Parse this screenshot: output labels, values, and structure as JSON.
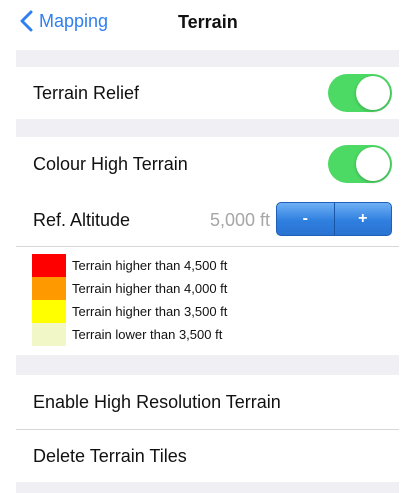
{
  "nav": {
    "back_label": "Mapping",
    "title": "Terrain"
  },
  "settings": {
    "terrain_relief": {
      "label": "Terrain Relief",
      "on": true
    },
    "colour_high_terrain": {
      "label": "Colour High Terrain",
      "on": true
    },
    "ref_altitude": {
      "label": "Ref. Altitude",
      "value": "5,000 ft",
      "minus_label": "-",
      "plus_label": "+"
    },
    "legend": [
      {
        "color": "#ff0000",
        "text": "Terrain higher than 4,500 ft"
      },
      {
        "color": "#ff9900",
        "text": "Terrain higher than 4,000 ft"
      },
      {
        "color": "#ffff00",
        "text": "Terrain higher than 3,500 ft"
      },
      {
        "color": "#f2f7c8",
        "text": "Terrain lower than 3,500 ft"
      }
    ],
    "high_res": {
      "label": "Enable High Resolution Terrain"
    },
    "delete_tiles": {
      "label": "Delete Terrain Tiles"
    }
  },
  "colors": {
    "accent": "#2f7ff0",
    "toggle_on": "#4cd964",
    "group_background": "#efeff4"
  }
}
